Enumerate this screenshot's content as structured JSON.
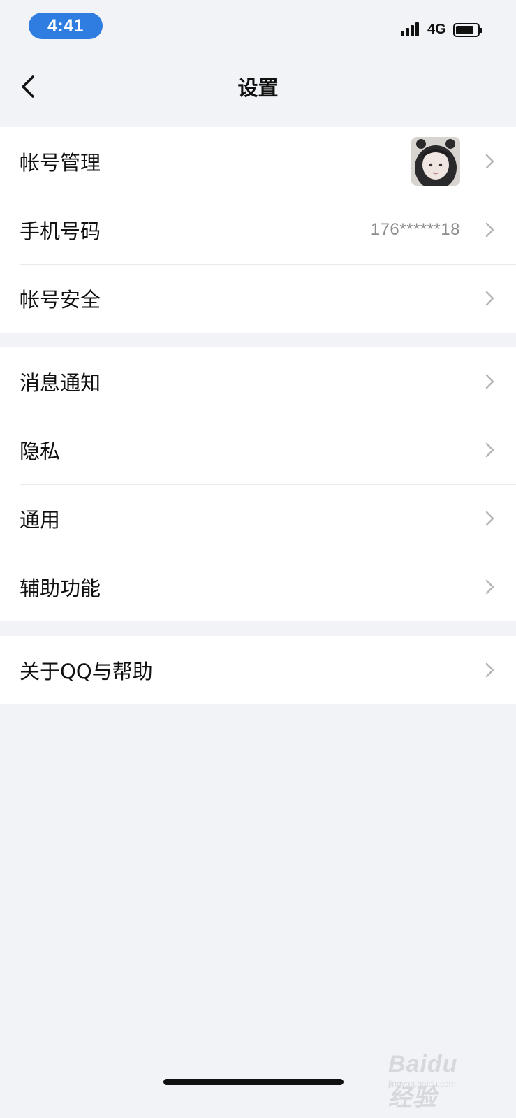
{
  "status_bar": {
    "time": "4:41",
    "network": "4G",
    "accent_color": "#2f7de1"
  },
  "nav": {
    "title": "设置",
    "back_icon": "chevron-left-icon"
  },
  "groups": [
    {
      "items": [
        {
          "label": "帐号管理",
          "value": "",
          "has_avatar": true
        },
        {
          "label": "手机号码",
          "value": "176******18"
        },
        {
          "label": "帐号安全",
          "value": ""
        }
      ]
    },
    {
      "items": [
        {
          "label": "消息通知"
        },
        {
          "label": "隐私"
        },
        {
          "label": "通用"
        },
        {
          "label": "辅助功能"
        }
      ]
    },
    {
      "items": [
        {
          "label": "关于QQ与帮助"
        }
      ]
    }
  ],
  "watermark": {
    "logo_text": "Baidu 经验",
    "sub_text": "jingyan.baidu.com"
  }
}
